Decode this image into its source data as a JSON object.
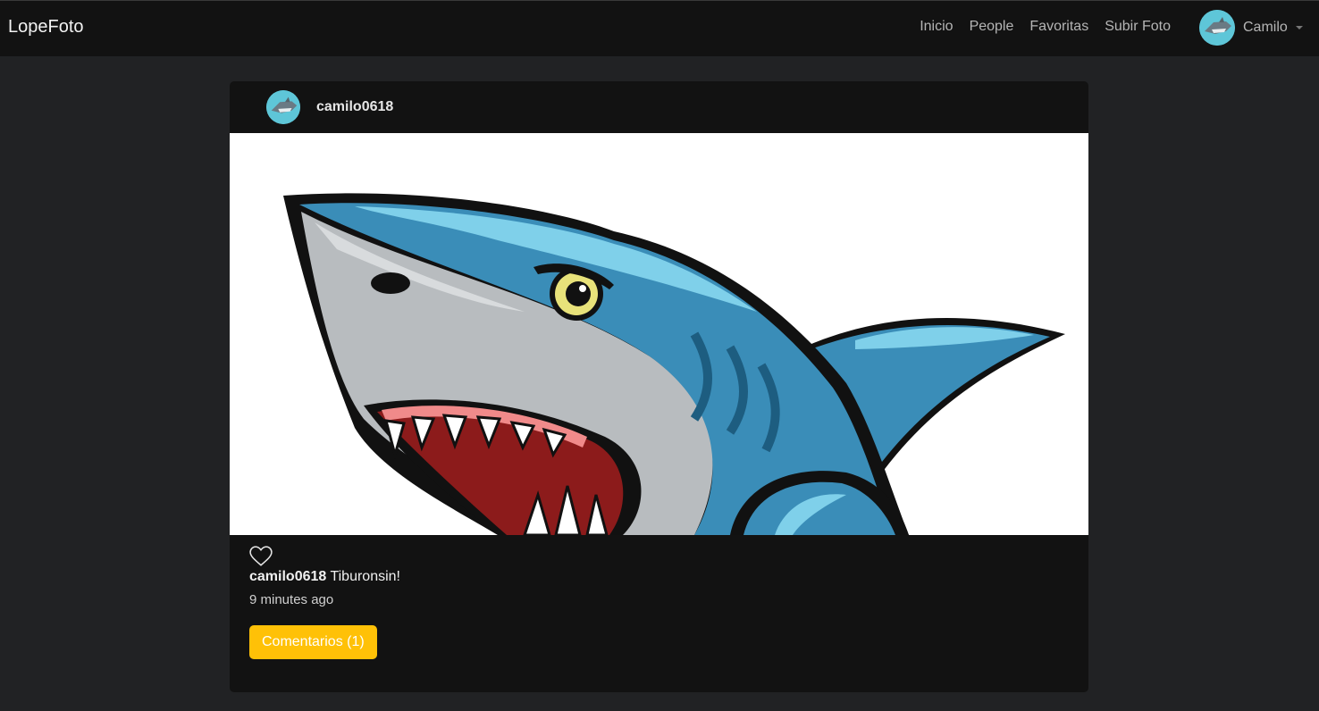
{
  "navbar": {
    "brand": "LopeFoto",
    "links": [
      "Inicio",
      "People",
      "Favoritas",
      "Subir Foto"
    ],
    "user_name": "Camilo"
  },
  "post": {
    "username": "camilo0618",
    "caption": "Tiburonsin!",
    "time_ago": "9 minutes ago",
    "comments_button": "Comentarios (1)",
    "liked": false
  },
  "colors": {
    "navbar_bg": "#121212",
    "page_bg": "#212224",
    "card_bg": "#121212",
    "accent_button": "#ffc107"
  },
  "icons": {
    "like": "heart-outline-icon",
    "user_menu": "caret-down-icon"
  }
}
